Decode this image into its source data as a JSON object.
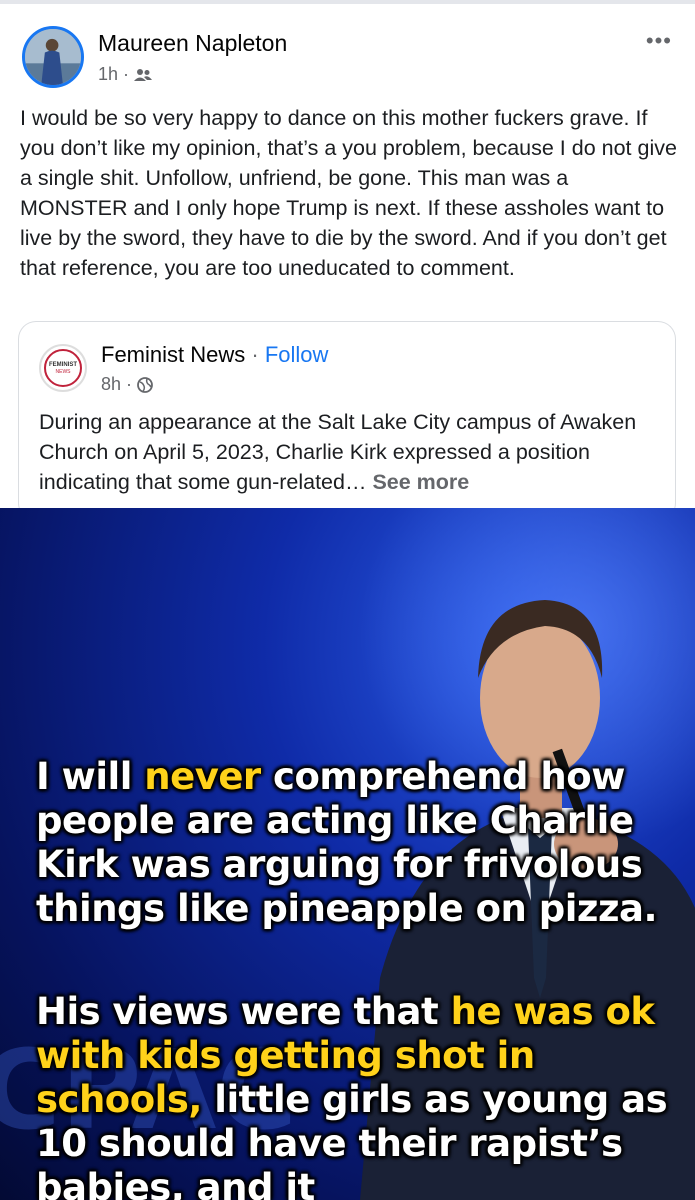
{
  "post": {
    "author": "Maureen Napleton",
    "time": "1h",
    "audience_icon": "friends-icon",
    "text": "I would be so very happy to dance on this mother fuckers grave. If you don’t like my opinion, that’s a you problem, because I do not give a single shit. Unfollow, unfriend, be gone. This man was a MONSTER and I only hope Trump is next. If these assholes want to live by the sword, they have to die by the sword. And if you don’t get that reference, you are too uneducated to comment.",
    "more_label": "•••"
  },
  "shared": {
    "page_name": "Feminist News",
    "separator": " · ",
    "follow_label": "Follow",
    "time": "8h",
    "audience_icon": "globe-icon",
    "avatar_line1": "FEMINIST",
    "avatar_line2": "NEWS",
    "text": "During an appearance at the Salt Lake City campus of Awaken Church on April 5, 2023, Charlie Kirk expressed a position indicating that some gun-related… ",
    "see_more_label": "See more"
  },
  "image": {
    "caption1_pre": "I will ",
    "caption1_hl": "never",
    "caption1_post": " comprehend how people are acting like Charlie Kirk was arguing for frivolous things like pineapple on pizza.",
    "caption2_pre": "His views were that ",
    "caption2_hl": "he was ok with kids getting shot in schools,",
    "caption2_post": " little girls as young as 10 should have their rapist’s babies, and it",
    "highlight_color": "#ffd21a"
  }
}
